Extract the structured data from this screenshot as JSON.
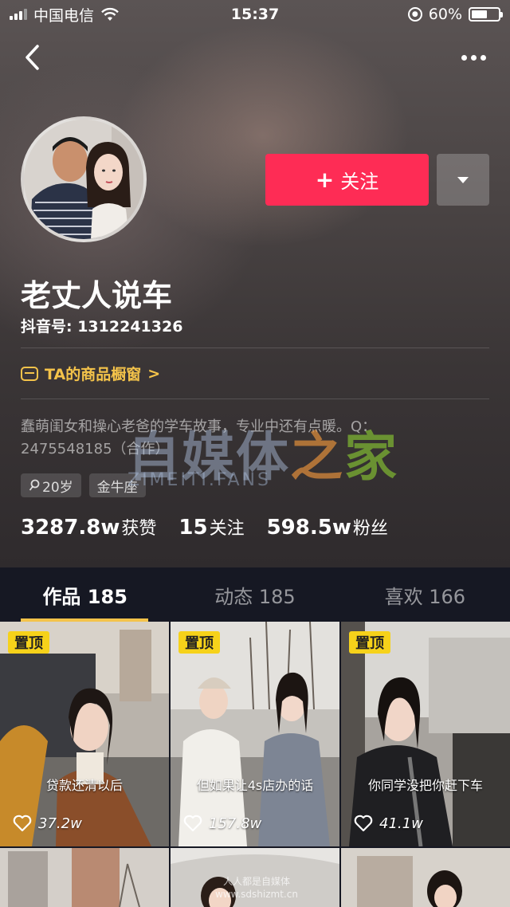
{
  "status_bar": {
    "carrier": "中国电信",
    "time": "15:37",
    "battery_text": "60%",
    "battery_level": 0.6
  },
  "profile": {
    "nickname": "老丈人说车",
    "douyin_id": "抖音号: 1312241326",
    "follow_label": "关注",
    "follow_plus": "+",
    "shop_label": "TA的商品橱窗",
    "shop_chevron": ">",
    "bio": "蠢萌闺女和操心老爸的学车故事，专业中还有点暖。Q：2475548185（合作）",
    "tags": [
      "20岁",
      "金牛座"
    ],
    "stats": [
      {
        "value": "3287.8w",
        "label": "获赞"
      },
      {
        "value": "15",
        "label": "关注"
      },
      {
        "value": "598.5w",
        "label": "粉丝"
      }
    ]
  },
  "watermark": {
    "main_a": "自媒体",
    "main_b": "之",
    "main_c": "家",
    "sub": "ZIMEITI.FANS",
    "corner_line1": "人人都是自媒体",
    "corner_line2": "www.sdshizmt.cn"
  },
  "tabs": [
    {
      "label": "作品 185",
      "active": true
    },
    {
      "label": "动态 185",
      "active": false
    },
    {
      "label": "喜欢 166",
      "active": false
    }
  ],
  "videos": [
    {
      "pinned": "置顶",
      "caption": "贷款还清以后",
      "likes": "37.2w"
    },
    {
      "pinned": "置顶",
      "caption": "但如果让4s店办的话",
      "likes": "157.8w"
    },
    {
      "pinned": "置顶",
      "caption": "你同学没把你赶下车",
      "likes": "41.1w"
    }
  ],
  "colors": {
    "accent_red": "#fe2c55",
    "gold": "#f4c34a",
    "pin_yellow": "#f6d21a",
    "dark_bg": "#161823"
  },
  "icons": [
    "back-icon",
    "more-icon",
    "dropdown-icon",
    "shop-icon",
    "heart-icon",
    "search-icon",
    "wifi-icon",
    "signal-icon",
    "battery-icon",
    "rotation-lock-icon"
  ]
}
